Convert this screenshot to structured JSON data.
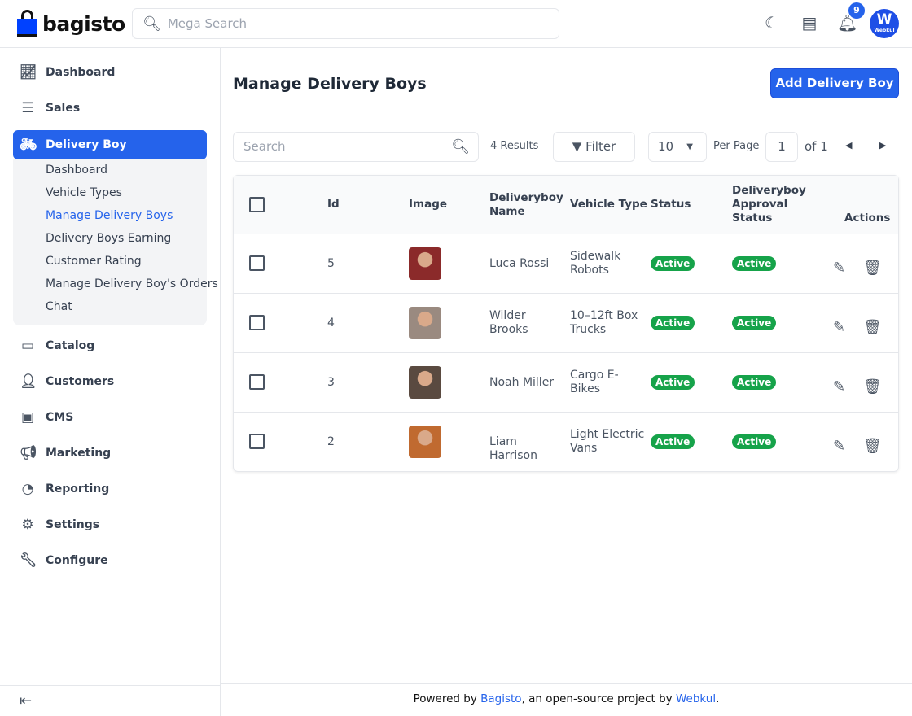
{
  "header": {
    "logo": "bagisto",
    "search_placeholder": "Mega Search",
    "notification_count": "9",
    "avatar_initial": "W",
    "avatar_label": "Webkul"
  },
  "sidebar": {
    "items": [
      {
        "label": "Dashboard",
        "icon": "chart-icon"
      },
      {
        "label": "Sales",
        "icon": "receipt-icon"
      },
      {
        "label": "Delivery Boy",
        "icon": "bicycle-icon"
      },
      {
        "label": "Catalog",
        "icon": "catalog-icon"
      },
      {
        "label": "Customers",
        "icon": "person-icon"
      },
      {
        "label": "CMS",
        "icon": "monitor-icon"
      },
      {
        "label": "Marketing",
        "icon": "megaphone-icon"
      },
      {
        "label": "Reporting",
        "icon": "pie-icon"
      },
      {
        "label": "Settings",
        "icon": "gear-icon"
      },
      {
        "label": "Configure",
        "icon": "wrench-icon"
      }
    ],
    "sub_items": [
      "Dashboard",
      "Vehicle Types",
      "Manage Delivery Boys",
      "Delivery Boys Earning",
      "Customer Rating",
      "Manage Delivery Boy's Orders",
      "Chat"
    ]
  },
  "main": {
    "title": "Manage Delivery Boys",
    "add_button": "Add Delivery Boy",
    "search_placeholder": "Search",
    "results": "4 Results",
    "filter": "Filter",
    "per_page_value": "10",
    "per_page_label": "Per Page",
    "page": "1",
    "of_pages": "of 1",
    "columns": [
      "Id",
      "Image",
      "Deliveryboy Name",
      "Vehicle Type",
      "Status",
      "Deliveryboy Approval Status",
      "Actions"
    ],
    "rows": [
      {
        "id": "5",
        "name": "Luca Rossi",
        "vehicle": "Sidewalk Robots",
        "status": "Active",
        "approval": "Active",
        "color": "#8b2a2a"
      },
      {
        "id": "4",
        "name": "Wilder Brooks",
        "vehicle": "10–12ft Box Trucks",
        "status": "Active",
        "approval": "Active",
        "color": "#9a8a80"
      },
      {
        "id": "3",
        "name": "Noah Miller",
        "vehicle": "Cargo E-Bikes",
        "status": "Active",
        "approval": "Active",
        "color": "#5a4a40"
      },
      {
        "id": "2",
        "name": "Liam Harrison",
        "vehicle": "Light Electric Vans",
        "status": "Active",
        "approval": "Active",
        "color": "#c06a30"
      }
    ]
  },
  "footer": {
    "prefix": "Powered by ",
    "bagisto": "Bagisto",
    "middle": ", an open-source project by ",
    "webkul": "Webkul",
    "suffix": "."
  }
}
